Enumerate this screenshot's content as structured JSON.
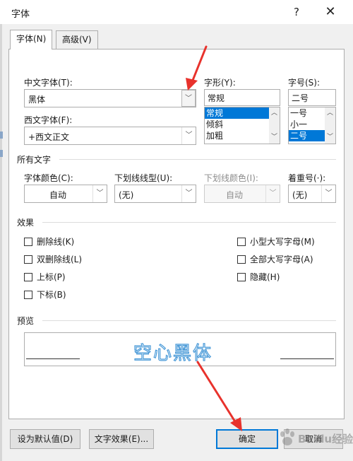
{
  "window": {
    "title": "字体",
    "help": "?",
    "close": "✕"
  },
  "tabs": [
    {
      "label": "字体(N)",
      "active": true
    },
    {
      "label": "高级(V)",
      "active": false
    }
  ],
  "font": {
    "cn_font_label": "中文字体(T):",
    "cn_font_value": "黑体",
    "west_font_label": "西文字体(F):",
    "west_font_value": "+西文正文",
    "style_label": "字形(Y):",
    "style_value": "常规",
    "style_options": [
      "常规",
      "倾斜",
      "加粗"
    ],
    "style_selected": "常规",
    "size_label": "字号(S):",
    "size_value": "二号",
    "size_options": [
      "一号",
      "小一",
      "二号"
    ],
    "size_selected": "二号"
  },
  "all_text": {
    "title": "所有文字",
    "color_label": "字体颜色(C):",
    "color_value": "自动",
    "underline_style_label": "下划线线型(U):",
    "underline_style_value": "(无)",
    "underline_color_label": "下划线颜色(I):",
    "underline_color_value": "自动",
    "emphasis_label": "着重号(·):",
    "emphasis_value": "(无)"
  },
  "effects": {
    "title": "效果",
    "left": [
      {
        "label": "删除线(K)",
        "checked": false
      },
      {
        "label": "双删除线(L)",
        "checked": false
      },
      {
        "label": "上标(P)",
        "checked": false
      },
      {
        "label": "下标(B)",
        "checked": false
      }
    ],
    "right": [
      {
        "label": "小型大写字母(M)",
        "checked": false
      },
      {
        "label": "全部大写字母(A)",
        "checked": false
      },
      {
        "label": "隐藏(H)",
        "checked": false
      }
    ]
  },
  "preview": {
    "title": "预览",
    "sample": "空心黑体"
  },
  "buttons": {
    "set_default": "设为默认值(D)",
    "text_effects": "文字效果(E)...",
    "ok": "确定",
    "cancel": "取消"
  },
  "watermark": {
    "text": "Baidu经验"
  },
  "colors": {
    "accent": "#0078d7",
    "annotation_arrow": "#e8322c",
    "hollow_text_stroke": "#4a9ad8"
  }
}
